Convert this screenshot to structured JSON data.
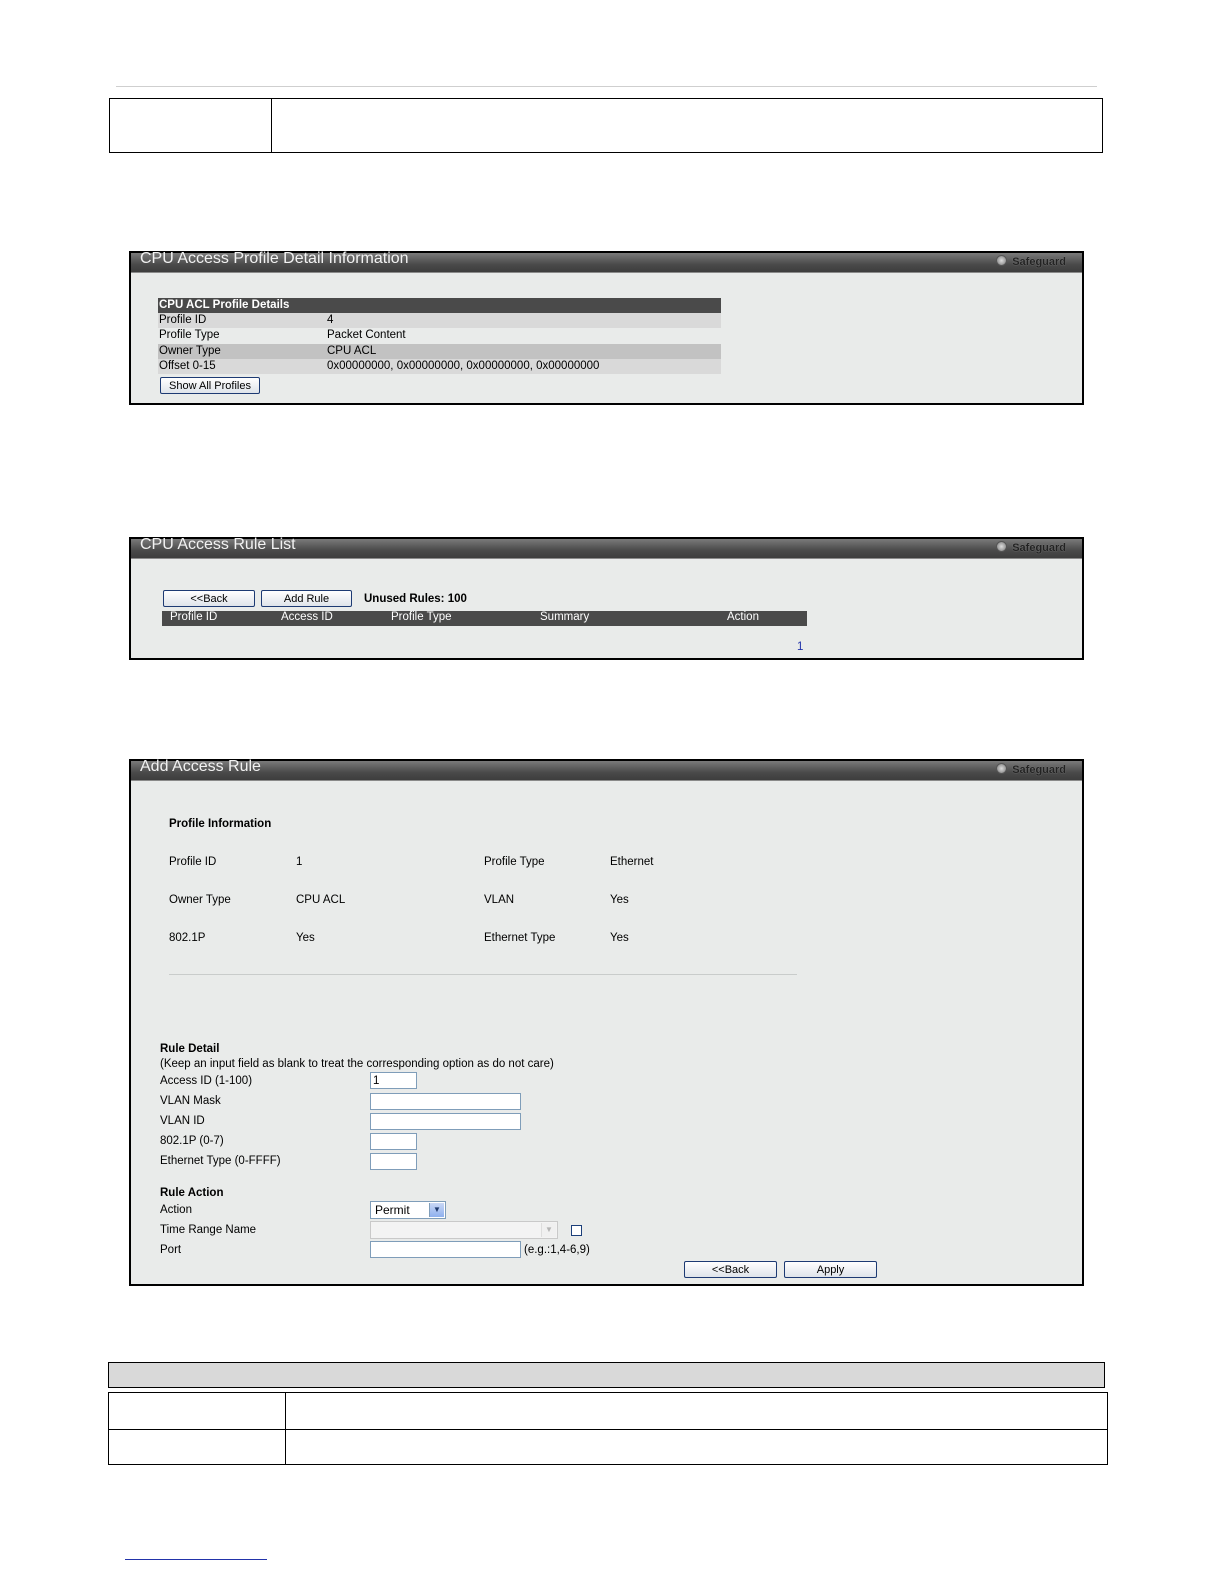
{
  "profile_detail_panel": {
    "title": "CPU Access Profile Detail Information",
    "badge": "Safeguard",
    "table_header": "CPU ACL Profile Details",
    "rows": [
      {
        "label": "Profile ID",
        "value": "4"
      },
      {
        "label": "Profile Type",
        "value": "Packet Content"
      },
      {
        "label": "Owner Type",
        "value": "CPU ACL"
      },
      {
        "label": "Offset 0-15",
        "value": "0x00000000, 0x00000000, 0x00000000, 0x00000000"
      }
    ],
    "show_all_button": "Show All Profiles"
  },
  "rule_list_panel": {
    "title": "CPU Access Rule List",
    "badge": "Safeguard",
    "back_button": "<<Back",
    "add_rule_button": "Add Rule",
    "unused_rules": "Unused Rules: 100",
    "columns": [
      "Profile ID",
      "Access ID",
      "Profile Type",
      "Summary",
      "Action"
    ],
    "page": "1"
  },
  "add_rule_panel": {
    "title": "Add Access Rule",
    "badge": "Safeguard",
    "profile_info_heading": "Profile Information",
    "profile_info": {
      "profile_id_label": "Profile ID",
      "profile_id_value": "1",
      "profile_type_label": "Profile Type",
      "profile_type_value": "Ethernet",
      "owner_type_label": "Owner Type",
      "owner_type_value": "CPU ACL",
      "vlan_label": "VLAN",
      "vlan_value": "Yes",
      "p8021_label": "802.1P",
      "p8021_value": "Yes",
      "ethertype_label": "Ethernet Type",
      "ethertype_value": "Yes"
    },
    "rule_detail_heading": "Rule Detail",
    "rule_detail_note": "(Keep an input field as blank to treat the corresponding option as do not care)",
    "fields": {
      "access_id_label": "Access ID (1-100)",
      "access_id_value": "1",
      "vlan_mask_label": "VLAN Mask",
      "vlan_id_label": "VLAN ID",
      "p8021_label": "802.1P  (0-7)",
      "ethertype_label": "Ethernet Type  (0-FFFF)"
    },
    "rule_action_heading": "Rule Action",
    "action_label": "Action",
    "action_value": "Permit",
    "time_range_label": "Time Range Name",
    "port_label": "Port",
    "port_hint": "(e.g.:1,4-6,9)",
    "back_button": "<<Back",
    "apply_button": "Apply"
  }
}
